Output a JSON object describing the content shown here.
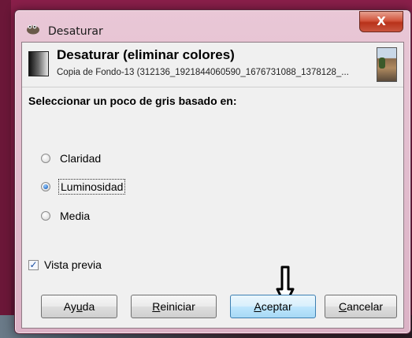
{
  "window": {
    "title": "Desaturar",
    "close_label": "X"
  },
  "header": {
    "title": "Desaturar (eliminar colores)",
    "subtitle": "Copia de Fondo-13 (312136_1921844060590_1676731088_1378128_..."
  },
  "options": {
    "section_label": "Seleccionar un poco de gris basado en:",
    "choices": [
      {
        "label": "Claridad",
        "selected": false
      },
      {
        "label": "Luminosidad",
        "selected": true
      },
      {
        "label": "Media",
        "selected": false
      }
    ]
  },
  "preview": {
    "label": "Vista previa",
    "checked": true
  },
  "buttons": {
    "help": {
      "pre": "Ay",
      "mnemonic": "u",
      "post": "da"
    },
    "reset": {
      "pre": "",
      "mnemonic": "R",
      "post": "einiciar"
    },
    "accept": {
      "pre": "",
      "mnemonic": "A",
      "post": "ceptar"
    },
    "cancel": {
      "pre": "",
      "mnemonic": "C",
      "post": "ancelar"
    }
  },
  "colors": {
    "title_bar": "#e9c7d6",
    "close_button": "#c9553f",
    "primary_button": "#bee6fd"
  },
  "icons": {
    "app": "gimp-wilber-icon",
    "operation": "desaturate-gradient-icon",
    "preview": "image-thumbnail",
    "annotation": "down-arrow-icon"
  }
}
